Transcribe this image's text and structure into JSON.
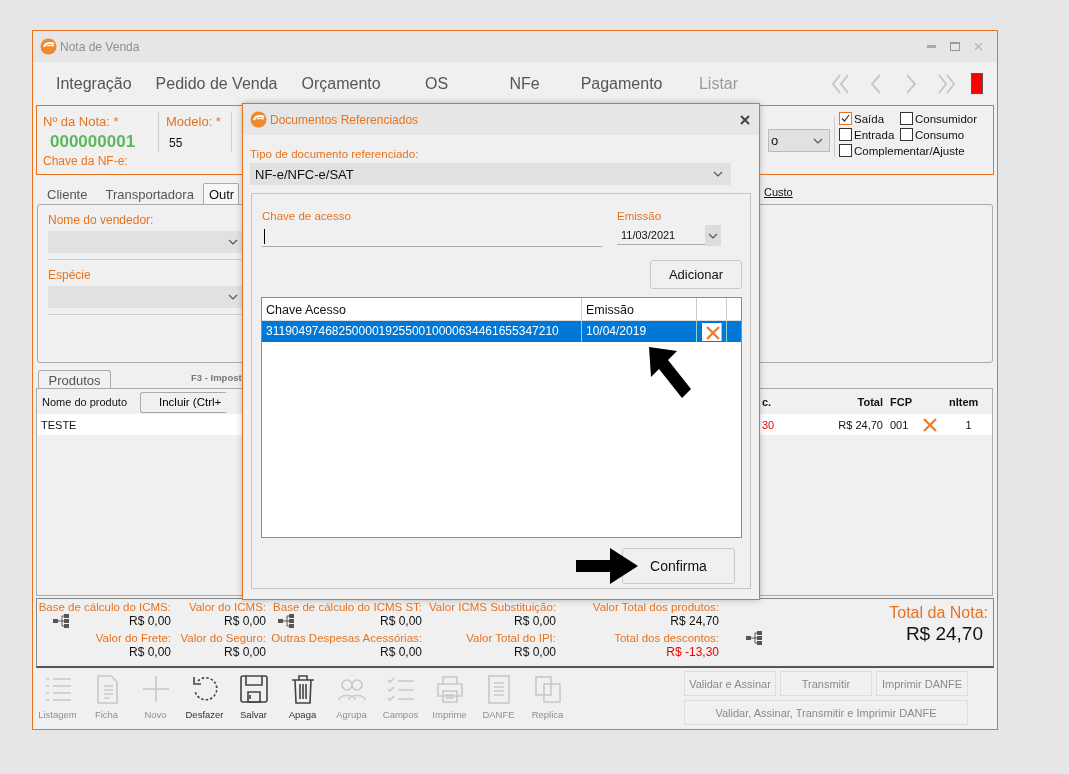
{
  "window": {
    "title": "Nota de Venda"
  },
  "menu": [
    {
      "label": "Integração",
      "disabled": false
    },
    {
      "label": "Pedido de Venda",
      "disabled": false
    },
    {
      "label": "Orçamento",
      "disabled": false
    },
    {
      "label": "OS",
      "disabled": false
    },
    {
      "label": "NFe",
      "disabled": false
    },
    {
      "label": "Pagamento",
      "disabled": false
    },
    {
      "label": "Listar",
      "disabled": true
    }
  ],
  "header": {
    "numero_label": "Nº da Nota: *",
    "numero": "000000001",
    "modelo_label": "Modelo: *",
    "modelo": "55",
    "chave_label": "Chave da NF-e:",
    "combo_value": "o"
  },
  "options": [
    {
      "label": "Saída",
      "checked": true
    },
    {
      "label": "Consumidor",
      "checked": false
    },
    {
      "label": "Entrada",
      "checked": false
    },
    {
      "label": "Consumo",
      "checked": false
    },
    {
      "label": "Complementar/Ajuste",
      "checked": false
    }
  ],
  "tabs": [
    {
      "label": "Cliente",
      "selected": false
    },
    {
      "label": "Transportadora",
      "selected": false
    },
    {
      "label": "Outr",
      "selected": true
    }
  ],
  "side_tab": {
    "label": "Custo"
  },
  "fields": [
    {
      "label": "Nome do vendedor:"
    },
    {
      "label": "Espécie"
    }
  ],
  "products": {
    "tab": "Produtos",
    "shortcut": "F3 - Impost",
    "add_button": "Incluir (Ctrl+",
    "columns": [
      "Nome do produto",
      "c.",
      "Total",
      "FCP",
      "nItem"
    ],
    "rows": [
      {
        "cells": [
          "TESTE",
          "30",
          "R$ 24,70",
          "001",
          "1"
        ]
      }
    ]
  },
  "totals": [
    {
      "label": "Base de cálculo do ICMS:",
      "value": "R$ 0,00",
      "icon": true,
      "negative": false
    },
    {
      "label": "Valor do ICMS:",
      "value": "R$ 0,00",
      "icon": false,
      "negative": false
    },
    {
      "label": "Base de cálculo do ICMS ST:",
      "value": "R$ 0,00",
      "icon": true,
      "negative": false
    },
    {
      "label": "Valor ICMS Substituição:",
      "value": "R$ 0,00",
      "icon": false,
      "negative": false
    },
    {
      "label": "Valor Total dos produtos:",
      "value": "R$ 24,70",
      "icon": false,
      "negative": false
    },
    {
      "label": "Valor do Frete:",
      "value": "R$ 0,00",
      "icon": false,
      "negative": false
    },
    {
      "label": "Valor do Seguro:",
      "value": "R$ 0,00",
      "icon": false,
      "negative": false
    },
    {
      "label": "Outras Despesas Acessórias:",
      "value": "R$ 0,00",
      "icon": false,
      "negative": false
    },
    {
      "label": "Valor Total do IPI:",
      "value": "R$ 0,00",
      "icon": false,
      "negative": false
    },
    {
      "label": "Total dos descontos:",
      "value": "R$ -13,30",
      "icon": false,
      "negative": true
    }
  ],
  "total_nota": {
    "label": "Total da Nota:",
    "value": "R$ 24,70"
  },
  "toolbar": [
    {
      "label": "Listagem",
      "kind": "list",
      "disabled": true
    },
    {
      "label": "Ficha",
      "kind": "sheet",
      "disabled": true
    },
    {
      "label": "Novo",
      "kind": "plus",
      "disabled": true
    },
    {
      "label": "Desfazer",
      "kind": "undo",
      "disabled": false
    },
    {
      "label": "Salvar",
      "kind": "save",
      "disabled": false
    },
    {
      "label": "Apaga",
      "kind": "trash",
      "disabled": false
    },
    {
      "label": "Agrupa",
      "kind": "people",
      "disabled": true
    },
    {
      "label": "Campos",
      "kind": "checklist",
      "disabled": true
    },
    {
      "label": "Imprime",
      "kind": "printer",
      "disabled": true
    },
    {
      "label": "DANFE",
      "kind": "document",
      "disabled": true
    },
    {
      "label": "Replica",
      "kind": "copy",
      "disabled": true
    }
  ],
  "actions": [
    {
      "label": "Validar e Assinar",
      "disabled": true
    },
    {
      "label": "Transmitir",
      "disabled": true
    },
    {
      "label": "Imprimir DANFE",
      "disabled": true
    },
    {
      "label": "Validar, Assinar, Transmitir e Imprimir DANFE",
      "disabled": true
    }
  ],
  "dialog": {
    "title": "Documentos Referenciados",
    "type_label": "Tipo de documento referenciado:",
    "type_value": "NF-e/NFC-e/SAT",
    "key_label": "Chave de acesso",
    "date_label": "Emissão",
    "date_value": "11/03/2021",
    "add_button": "Adicionar",
    "columns": [
      "Chave Acesso",
      "Emissão"
    ],
    "rows": [
      {
        "key": "31190497468250000192550010000634461655347210",
        "date": "10/04/2019",
        "selected": true
      }
    ],
    "confirm_button": "Confirma"
  }
}
